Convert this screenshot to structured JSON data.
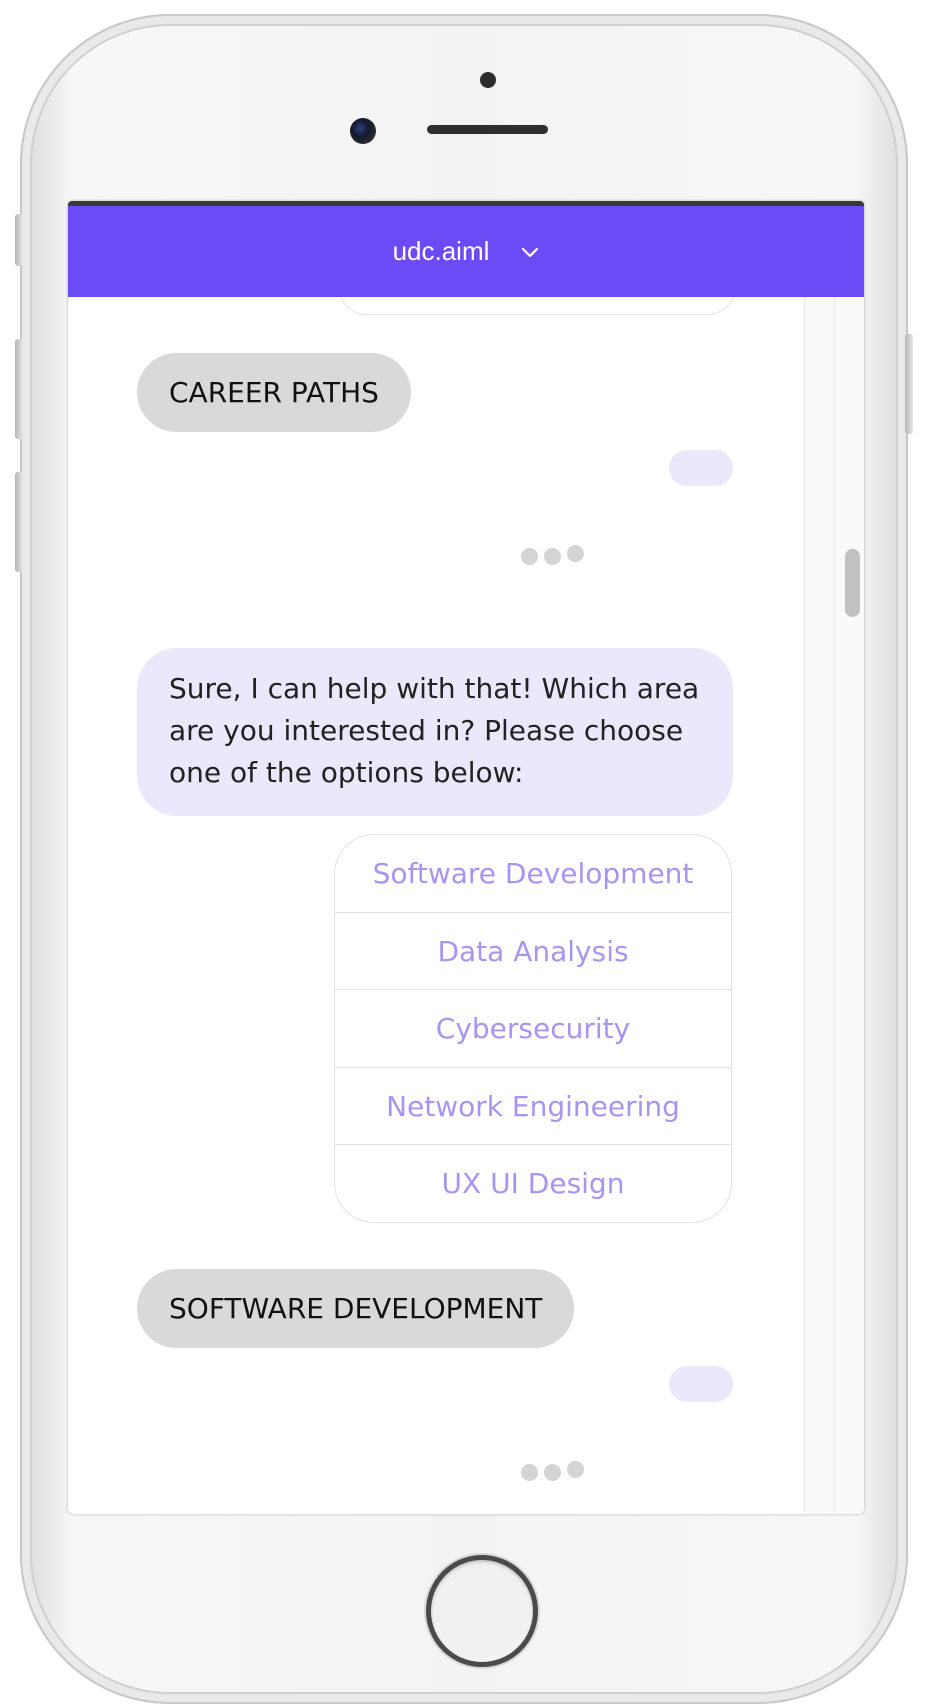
{
  "header": {
    "title": "udc.aiml",
    "chevron_icon": "chevron-down-icon",
    "background": "#6c4af5"
  },
  "messages": {
    "user_1": "CAREER PATHS",
    "bot_1": "Sure, I can help with that! Which area are you interested in? Please choose one of the options below:",
    "user_2": "SOFTWARE DEVELOPMENT"
  },
  "options": [
    {
      "label": "Software Development"
    },
    {
      "label": "Data Analysis"
    },
    {
      "label": "Cybersecurity"
    },
    {
      "label": "Network Engineering"
    },
    {
      "label": "UX UI Design"
    }
  ],
  "colors": {
    "accent": "#6c4af5",
    "bot_bubble": "#ebe8fc",
    "user_bubble": "#d9d9d9",
    "option_text": "#a994f2"
  }
}
